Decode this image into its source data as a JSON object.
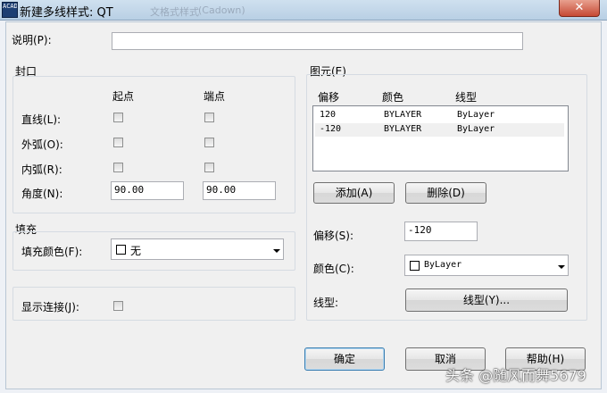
{
  "window": {
    "title": "新建多线样式: QT",
    "ghost_text_left": "文格式样式",
    "ghost_text_right": "(Cadown)",
    "close_label": "✕",
    "icon_label": "ACAD"
  },
  "description": {
    "label": "说明(P):",
    "value": ""
  },
  "caps": {
    "title": "封口",
    "col_start": "起点",
    "col_end": "端点",
    "rows": [
      {
        "label": "直线(L):",
        "start_checked": false,
        "end_checked": false
      },
      {
        "label": "外弧(O):",
        "start_checked": false,
        "end_checked": false
      },
      {
        "label": "内弧(R):",
        "start_checked": false,
        "end_checked": false
      }
    ],
    "angle_label": "角度(N):",
    "angle_start": "90.00",
    "angle_end": "90.00"
  },
  "fill": {
    "title": "填充",
    "color_label": "填充颜色(F):",
    "color_value": "无"
  },
  "display_joints": {
    "label": "显示连接(J):",
    "checked": false
  },
  "elements": {
    "title": "图元(E)",
    "headers": {
      "offset": "偏移",
      "color": "颜色",
      "linetype": "线型"
    },
    "rows": [
      {
        "offset": "120",
        "color": "BYLAYER",
        "linetype": "ByLayer"
      },
      {
        "offset": "-120",
        "color": "BYLAYER",
        "linetype": "ByLayer"
      }
    ],
    "add_label": "添加(A)",
    "delete_label": "删除(D)",
    "offset_label": "偏移(S):",
    "offset_value": "-120",
    "color_label": "颜色(C):",
    "color_value": "ByLayer",
    "linetype_label": "线型:",
    "linetype_button": "线型(Y)..."
  },
  "footer": {
    "ok_label": "确定",
    "cancel_label": "取消",
    "help_label": "帮助(H)"
  },
  "watermark": "头条 @随风而舞5679"
}
